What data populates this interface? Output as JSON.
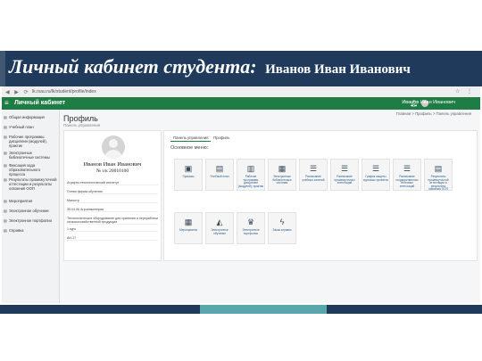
{
  "slide": {
    "title": "Личный кабинет студента:",
    "student_name": "Иванов Иван Иванович"
  },
  "browser": {
    "url": "lk.rsau.ru/lk/student/profile/index"
  },
  "app": {
    "title": "Личный кабинет",
    "user": "Иванов Иван Иванович"
  },
  "sidebar": {
    "items": [
      {
        "label": "Общая информация",
        "icon": "info-icon"
      },
      {
        "label": "Учебный план",
        "icon": "plan-icon"
      },
      {
        "label": "Рабочие программы дисциплин (модулей), практик",
        "icon": "programs-icon"
      },
      {
        "label": "Электронные библиотечные системы",
        "icon": "library-icon"
      },
      {
        "label": "Фиксация хода образовательного процесса",
        "icon": "process-icon"
      },
      {
        "label": "Результаты промежуточной аттестации и результаты освоения ООП",
        "icon": "results-icon"
      },
      {
        "label": "Мероприятия",
        "icon": "events-icon"
      },
      {
        "label": "Электронное обучение",
        "icon": "elearning-icon"
      },
      {
        "label": "Электронное портфолио",
        "icon": "portfolio-icon"
      },
      {
        "label": "Справка",
        "icon": "help-icon"
      }
    ]
  },
  "page": {
    "title": "Профиль",
    "subtitle": "Панель управления",
    "breadcrumb": "Главная > Профиль > Панель управления"
  },
  "profile": {
    "name": "Иванов Иван Иванович",
    "record_no": "№ з/к 20010100",
    "rows": [
      "Аграрно-технологический институт",
      "Очная форма обучения",
      "Магистр",
      "35.04.06 Агроинженерия",
      "Технологическое оборудование для хранения и переработки сельскохозяйственной продукции",
      "1 курс",
      "АИ-17"
    ]
  },
  "panel": {
    "tabs": [
      "Панель управления",
      "Профиль"
    ],
    "menu_heading": "Основное меню:",
    "tiles": [
      {
        "label": "Приказы",
        "icon": "orders-icon"
      },
      {
        "label": "Учебный план",
        "icon": "plan-icon"
      },
      {
        "label": "Рабочие программы дисциплин (модулей), практик",
        "icon": "programs-icon"
      },
      {
        "label": "Электронные библиотечные системы",
        "icon": "library-icon"
      },
      {
        "label": "Расписание учебных занятий",
        "icon": "schedule-icon"
      },
      {
        "label": "Расписание промежуточных аттестаций",
        "icon": "exam-schedule-icon"
      },
      {
        "label": "График защиты курсовых проектов",
        "icon": "coursework-icon"
      },
      {
        "label": "Расписание государственных итоговых аттестаций",
        "icon": "gia-icon"
      },
      {
        "label": "Результаты промежуточной аттестации и результаты освоения ООП",
        "icon": "results-icon"
      },
      {
        "label": "Мероприятия",
        "icon": "events-icon"
      },
      {
        "label": "Электронное обучение",
        "icon": "elearning-icon"
      },
      {
        "label": "Электронное портфолио",
        "icon": "portfolio-icon"
      },
      {
        "label": "Заказ справок",
        "icon": "certificate-icon"
      }
    ]
  },
  "colors": {
    "title_band": "#1f3a5a",
    "app_green": "#1e7d44",
    "footer_teal": "#5aa6ad"
  }
}
